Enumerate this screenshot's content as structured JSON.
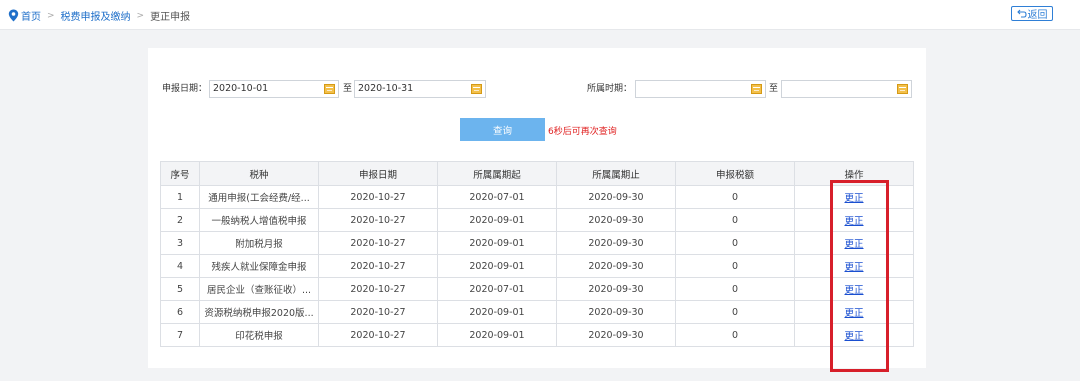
{
  "breadcrumb": {
    "home": "首页",
    "separator": ">",
    "level2": "税费申报及缴纳",
    "current": "更正申报"
  },
  "back_button": "返回",
  "filters": {
    "declare_date_label": "申报日期：",
    "declare_date_start": "2020-10-01",
    "to_label": "至",
    "declare_date_end": "2020-10-31",
    "period_label": "所属时期：",
    "period_start": "",
    "period_end": ""
  },
  "query": {
    "button_label": "查询",
    "hint": "6秒后可再次查询"
  },
  "table": {
    "columns": [
      "序号",
      "税种",
      "申报日期",
      "所属属期起",
      "所属属期止",
      "申报税额",
      "操作"
    ],
    "rows": [
      [
        "1",
        "通用申报(工会经费/经...",
        "2020-10-27",
        "2020-07-01",
        "2020-09-30",
        "0",
        "更正"
      ],
      [
        "2",
        "一般纳税人增值税申报",
        "2020-10-27",
        "2020-09-01",
        "2020-09-30",
        "0",
        "更正"
      ],
      [
        "3",
        "附加税月报",
        "2020-10-27",
        "2020-09-01",
        "2020-09-30",
        "0",
        "更正"
      ],
      [
        "4",
        "残疾人就业保障金申报",
        "2020-10-27",
        "2020-09-01",
        "2020-09-30",
        "0",
        "更正"
      ],
      [
        "5",
        "居民企业（查账征收）...",
        "2020-10-27",
        "2020-07-01",
        "2020-09-30",
        "0",
        "更正"
      ],
      [
        "6",
        "资源税纳税申报2020版...",
        "2020-10-27",
        "2020-09-01",
        "2020-09-30",
        "0",
        "更正"
      ],
      [
        "7",
        "印花税申报",
        "2020-10-27",
        "2020-09-01",
        "2020-09-30",
        "0",
        "更正"
      ]
    ]
  },
  "colors": {
    "accent": "#1f6fc9",
    "query_button": "#6cb4ee",
    "hint": "#e02020",
    "highlight_box": "#d71f2a"
  }
}
